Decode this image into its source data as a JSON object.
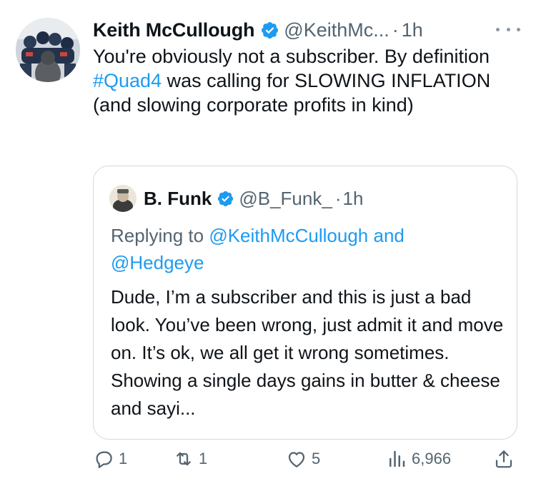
{
  "tweet": {
    "author_name": "Keith McCullough",
    "author_handle": "@KeithMc...",
    "separator": "·",
    "time": "1h",
    "text_before": "You're obviously not a subscriber. By definition ",
    "hashtag": "#Quad4",
    "text_after": " was calling for SLOWING INFLATION (and slowing corporate profits in kind)"
  },
  "quote": {
    "author_name": "B. Funk",
    "author_handle": "@B_Funk_",
    "separator": "·",
    "time": "1h",
    "replying_prefix": "Replying to ",
    "mention_1": "@KeithMcCullough",
    "replying_and": " and",
    "mention_2": "@Hedgeye",
    "text": "Dude, I’m a subscriber and this is just a bad look.  You’ve been wrong, just admit it and move on.  It’s ok, we all get it wrong sometimes. Showing a single days gains in butter & cheese and sayi..."
  },
  "actions": {
    "replies": "1",
    "retweets": "1",
    "likes": "5",
    "views": "6,966"
  },
  "colors": {
    "link": "#1d9bf0",
    "secondary": "#536471",
    "verified": "#1d9bf0",
    "border": "#cfd9de"
  },
  "icons": [
    "verified-badge-icon",
    "more-options-icon",
    "reply-icon",
    "retweet-icon",
    "like-icon",
    "views-icon",
    "share-icon"
  ]
}
